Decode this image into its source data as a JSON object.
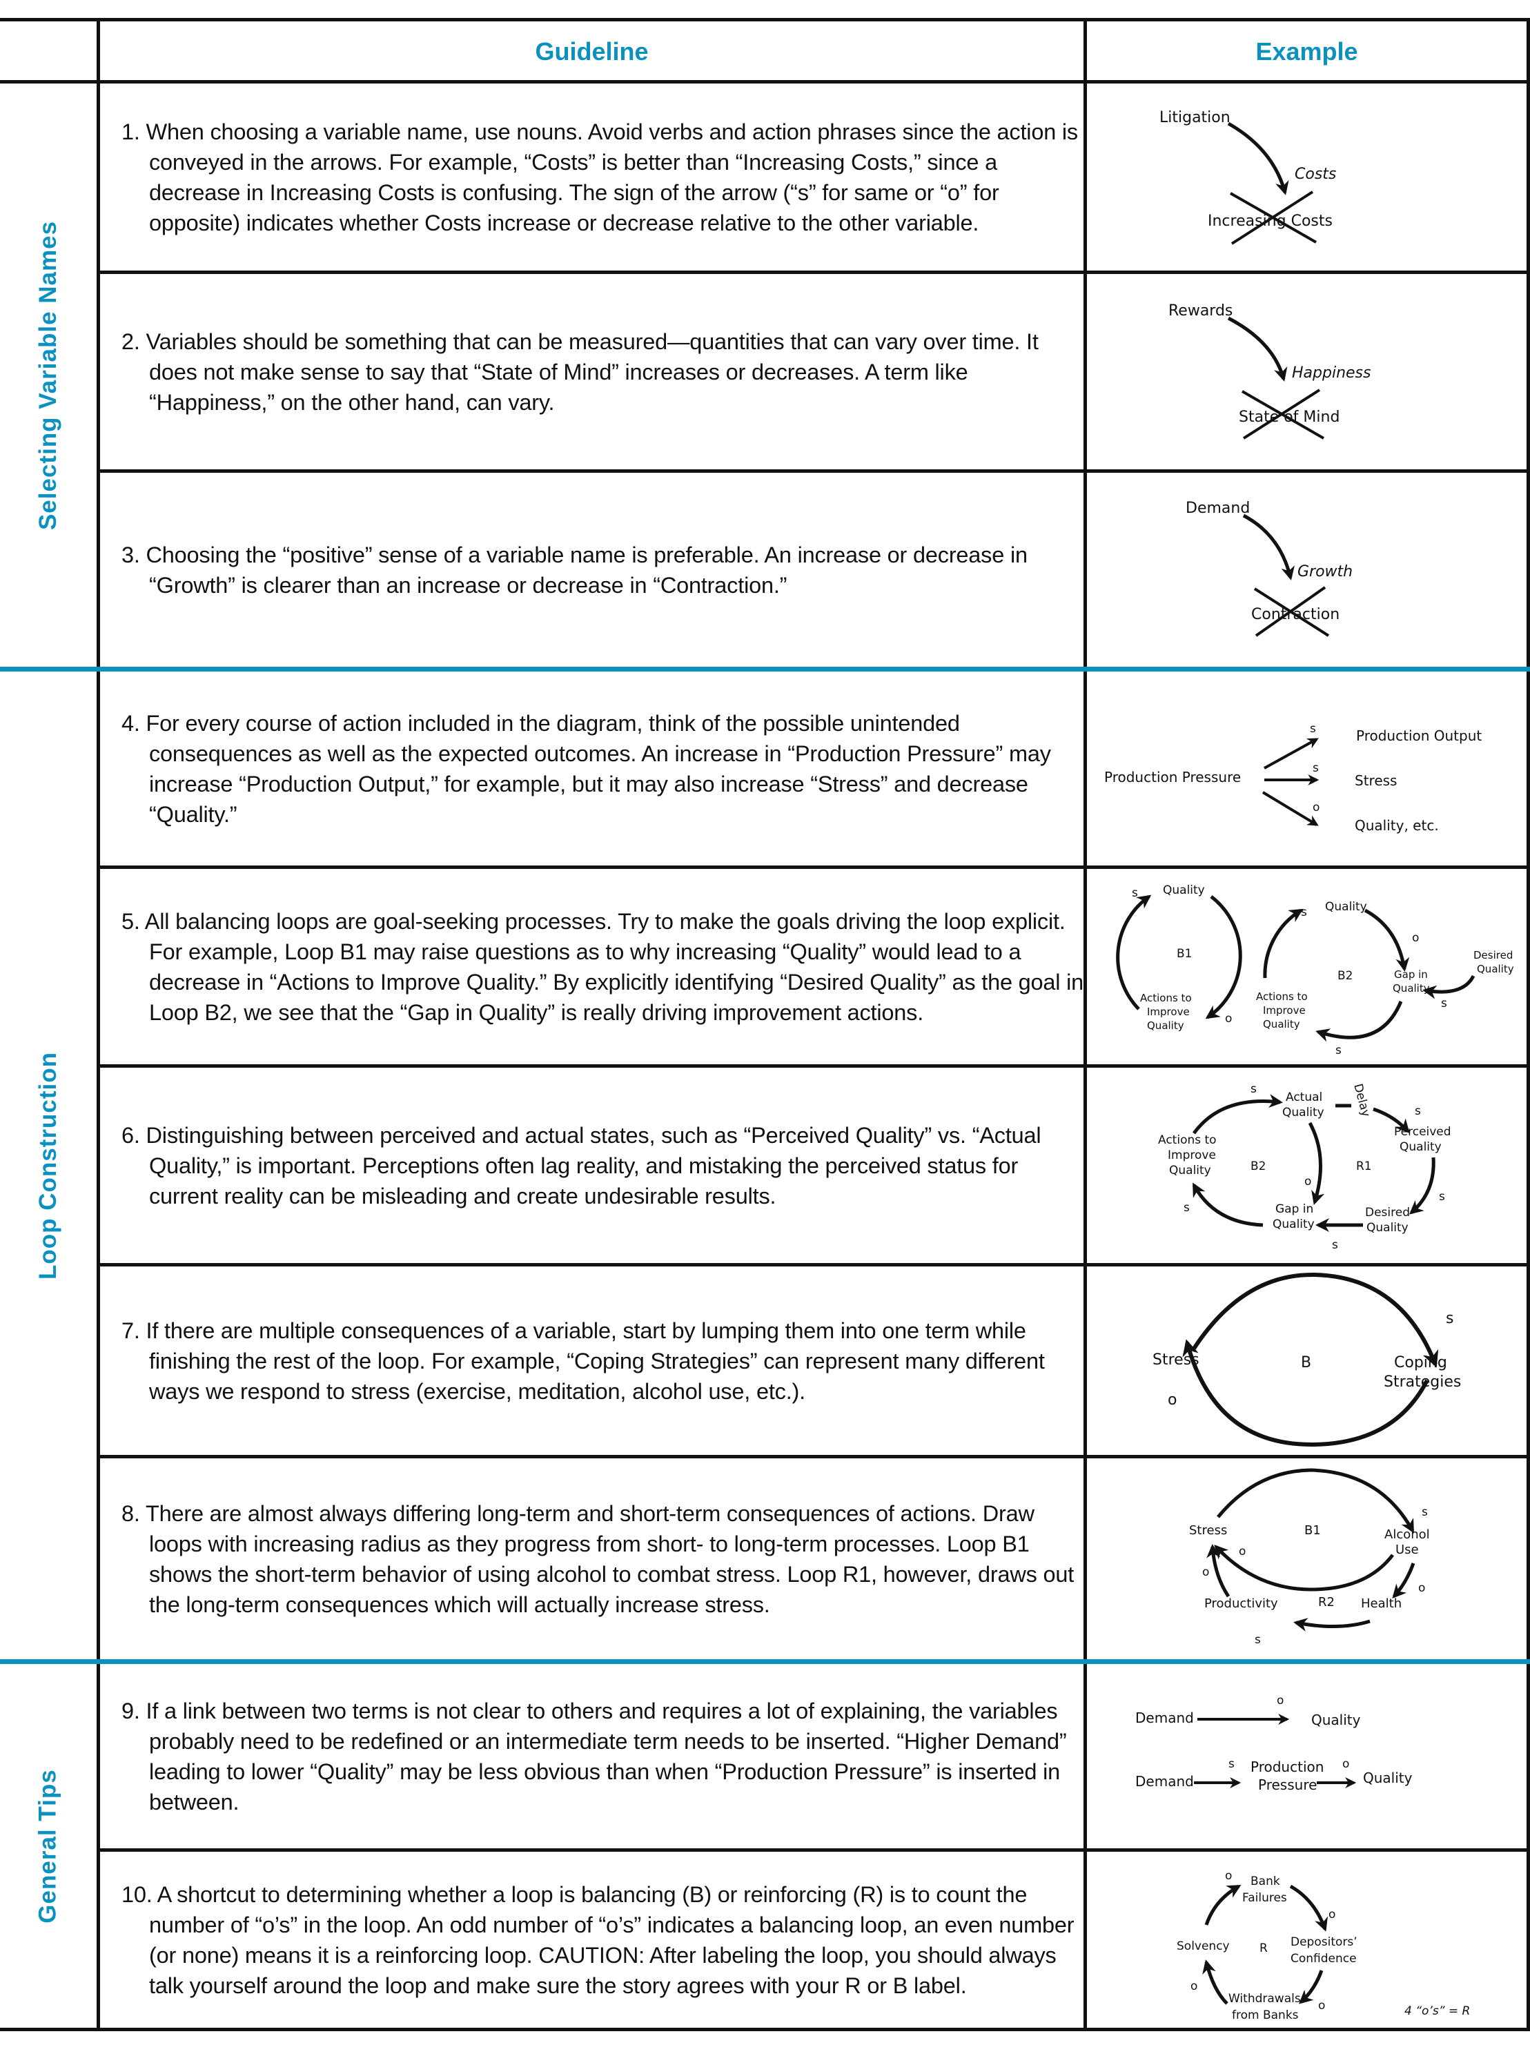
{
  "header": {
    "guideline": "Guideline",
    "example": "Example"
  },
  "sections": [
    {
      "label": "Selecting Variable Names",
      "rows": [
        1,
        2,
        3
      ]
    },
    {
      "label": "Loop Construction",
      "rows": [
        4,
        5,
        6,
        7,
        8
      ]
    },
    {
      "label": "General Tips",
      "rows": [
        9,
        10
      ]
    }
  ],
  "accent_color": "#0a91c0",
  "guidelines": [
    "1. When choosing a variable name, use nouns. Avoid verbs and action phrases since the action is conveyed in the arrows. For example, “Costs” is better than “Increasing Costs,” since a decrease in Increasing Costs is confusing. The sign of the arrow (“s” for same or “o” for opposite) indicates whether Costs increase or decrease relative to the other variable.",
    "2. Variables should be something that can be measured—quantities that can vary over time. It does not make sense to say that “State of Mind” increases or decreases. A term like “Happiness,” on the other hand, can vary.",
    "3. Choosing the “positive” sense of a variable name is preferable. An increase or decrease in “Growth” is clearer than an increase or decrease in “Contraction.”",
    "4. For every course of action included in the diagram, think of the possible unintended consequences as well as the expected outcomes. An increase in “Production Pressure” may increase “Production Output,” for example, but it may also increase “Stress” and decrease “Quality.”",
    "5. All balancing loops are goal-seeking processes. Try to make the goals driving the loop explicit. For example, Loop B1 may raise questions as to why increasing “Quality” would lead to a decrease in “Actions to Improve Quality.”  By explicitly identifying “Desired Quality” as the goal in Loop B2, we see that the “Gap in Quality” is really driving improvement actions.",
    "6. Distinguishing between perceived and actual states, such as “Perceived Quality” vs. “Actual Quality,” is important. Perceptions often lag reality, and mistaking the perceived status for current reality can be misleading and create undesirable results.",
    "7. If there are multiple consequences of a variable, start by lumping them into one term while finishing the rest of the loop. For example, “Coping Strategies” can represent many different ways we respond to stress (exercise, meditation, alcohol use, etc.).",
    "8. There are almost always differing long-term and short-term consequences of actions. Draw loops with increasing radius as they progress from short- to long-term processes. Loop B1 shows the short-term behavior of using alcohol to combat stress. Loop R1, however, draws out the long-term consequences which will actually increase stress.",
    "9. If a link between two terms is not clear to others and requires a lot of explaining, the variables probably need to be redefined or an intermediate term needs to be inserted. “Higher Demand” leading to lower “Quality” may be less obvious than when “Production Pressure” is inserted in between.",
    "10. A shortcut to determining whether a loop is balancing (B) or reinforcing (R) is to count the number of “o’s” in the loop. An odd number of “o’s” indicates a balancing loop, an even number (or none) means it is a reinforcing loop. CAUTION: After labeling the loop, you should always talk yourself around the loop and make sure the story agrees with your R or B label."
  ],
  "examples": {
    "e1": {
      "from": "Litigation",
      "to": "Costs",
      "crossed": "Increasing Costs"
    },
    "e2": {
      "from": "Rewards",
      "to": "Happiness",
      "crossed": "State of Mind"
    },
    "e3": {
      "from": "Demand",
      "to": "Growth",
      "crossed": "Contraction"
    },
    "e4": {
      "source": "Production Pressure",
      "targets": [
        "Production Output",
        "Stress",
        "Quality, etc."
      ],
      "signs": [
        "s",
        "s",
        "o"
      ]
    },
    "e5": {
      "b1": {
        "label": "B1",
        "top": "Quality",
        "bottom": [
          "Actions to",
          "Improve",
          "Quality"
        ],
        "signs": [
          "s",
          "o"
        ]
      },
      "b2": {
        "label": "B2",
        "top": "Quality",
        "gap": [
          "Gap in",
          "Quality"
        ],
        "desired": [
          "Desired",
          "Quality"
        ],
        "actions": [
          "Actions to",
          "Improve",
          "Quality"
        ],
        "signs": [
          "s",
          "o",
          "s",
          "s"
        ]
      }
    },
    "e6": {
      "actual": [
        "Actual",
        "Quality"
      ],
      "delay": "Delay",
      "perceived": [
        "Perceived",
        "Quality"
      ],
      "desired": [
        "Desired",
        "Quality"
      ],
      "gap": [
        "Gap in",
        "Quality"
      ],
      "actions": [
        "Actions to",
        "Improve",
        "Quality"
      ],
      "b2": "B2",
      "r1": "R1",
      "signs": [
        "s",
        "s",
        "s",
        "s",
        "s",
        "o"
      ]
    },
    "e7": {
      "left": "Stress",
      "right": [
        "Coping",
        "Strategies"
      ],
      "label": "B",
      "signs": [
        "s",
        "o"
      ]
    },
    "e8": {
      "stress": "Stress",
      "alcohol": [
        "Alcohol",
        "Use"
      ],
      "health": "Health",
      "productivity": "Productivity",
      "b1": "B1",
      "r2": "R2",
      "signs": [
        "s",
        "o",
        "o",
        "s",
        "o"
      ]
    },
    "e9": {
      "row1": [
        "Demand",
        "Quality"
      ],
      "row1_sign": "o",
      "row2": [
        "Demand",
        "Production",
        "Pressure",
        "Quality"
      ],
      "row2_signs": [
        "s",
        "o"
      ]
    },
    "e10": {
      "bank": [
        "Bank",
        "Failures"
      ],
      "depositors": [
        "Depositors’",
        "Confidence"
      ],
      "withdrawals": [
        "Withdrawals",
        "from Banks"
      ],
      "solvency": "Solvency",
      "label": "R",
      "signs": [
        "o",
        "o",
        "o",
        "o"
      ],
      "note": "4 “o’s” = R"
    }
  }
}
